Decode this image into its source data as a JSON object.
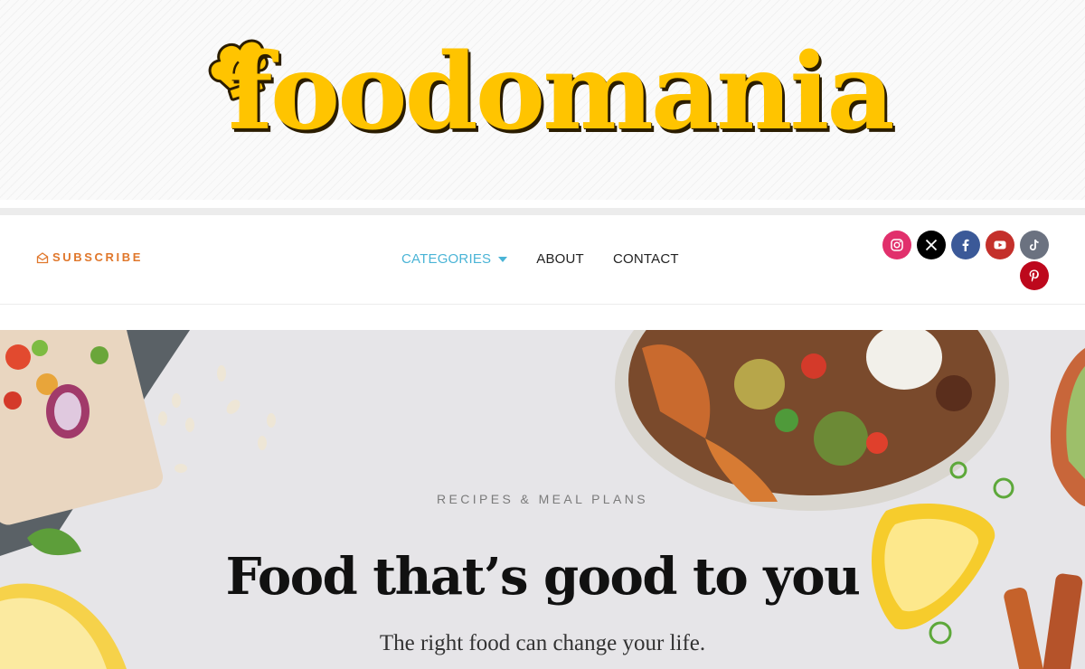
{
  "site": {
    "logo_text": "foodomania",
    "brand_color": "#ffc400",
    "logo_icon": "chef-hat-icon"
  },
  "nav": {
    "subscribe_label": "SUBSCRIBE",
    "subscribe_icon": "envelope-icon",
    "accent_color": "#e0772b",
    "menu": [
      {
        "label": "CATEGORIES",
        "active": true,
        "has_dropdown": true
      },
      {
        "label": "ABOUT"
      },
      {
        "label": "CONTACT"
      }
    ],
    "active_color": "#4ab4d6"
  },
  "socials": [
    {
      "name": "instagram-icon",
      "color": "#e1306c"
    },
    {
      "name": "x-icon",
      "color": "#000000"
    },
    {
      "name": "facebook-icon",
      "color": "#3b5998"
    },
    {
      "name": "youtube-icon",
      "color": "#c4302b"
    },
    {
      "name": "tiktok-icon",
      "color": "#6b7280"
    },
    {
      "name": "pinterest-icon",
      "color": "#bd081c"
    }
  ],
  "hero": {
    "eyebrow": "RECIPES & MEAL PLANS",
    "headline": "Food that’s good to you",
    "subline": "The right food can change your life."
  }
}
